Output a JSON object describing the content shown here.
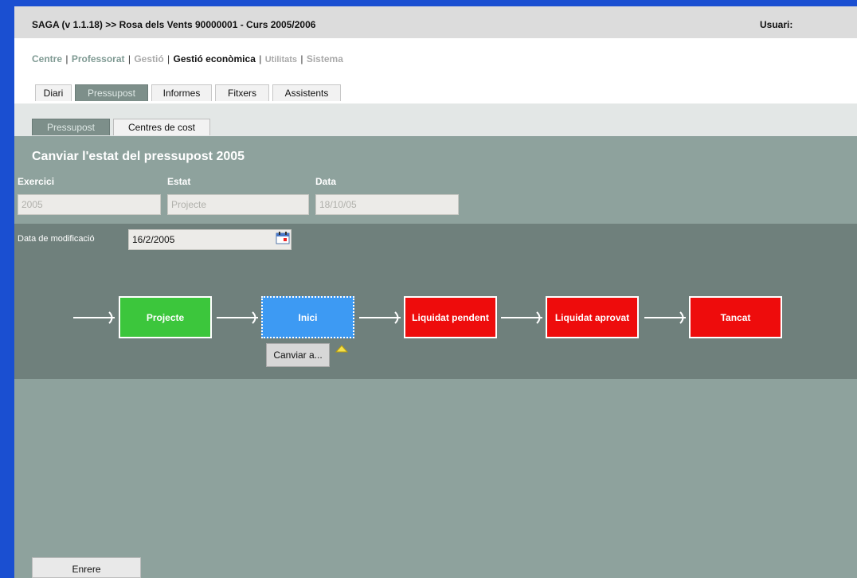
{
  "header": {
    "title": "SAGA (v 1.1.18) >> Rosa dels Vents 90000001 - Curs 2005/2006",
    "user_label": "Usuari:"
  },
  "menu": {
    "items": [
      "Centre",
      "Professorat",
      "Gestió",
      "Gestió econòmica",
      "Utilitats",
      "Sistema"
    ],
    "separator": "|",
    "active": "Gestió econòmica"
  },
  "tabs": [
    "Diari",
    "Pressupost",
    "Informes",
    "Fitxers",
    "Assistents"
  ],
  "selected_tab": "Pressupost",
  "subtabs": [
    "Pressupost",
    "Centres de cost"
  ],
  "selected_subtab": "Pressupost",
  "page_title": "Canviar l'estat del pressupost 2005",
  "fields": {
    "exercici": {
      "label": "Exercici",
      "value": "2005"
    },
    "estat": {
      "label": "Estat",
      "value": "Projecte"
    },
    "data": {
      "label": "Data",
      "value": "18/10/05"
    }
  },
  "modification": {
    "label": "Data de modificació",
    "value": "16/2/2005",
    "icon": "calendar-icon"
  },
  "workflow": {
    "states": [
      {
        "label": "Projecte",
        "color": "#3cc63c"
      },
      {
        "label": "Inici",
        "color": "#3d9af3"
      },
      {
        "label": "Liquidat pendent",
        "color": "#ee0c0c"
      },
      {
        "label": "Liquidat aprovat",
        "color": "#ee0c0c"
      },
      {
        "label": "Tancat",
        "color": "#ee0c0c"
      }
    ],
    "current": "Inici",
    "action_button": "Canviar a...",
    "action_icon": "triangle-up-icon"
  },
  "back_button": "Enrere",
  "colors": {
    "frame_border": "#1a4fd1",
    "background": "#8ea29d",
    "panel": "#6f807c",
    "title_bar": "#dcdcdc"
  }
}
